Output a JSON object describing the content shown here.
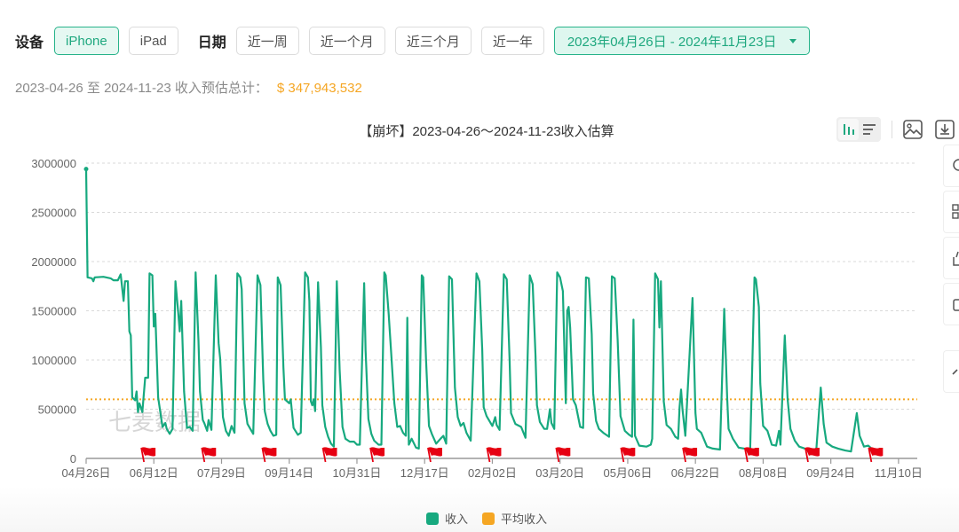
{
  "filters": {
    "device_label": "设备",
    "devices": [
      {
        "label": "iPhone",
        "active": true
      },
      {
        "label": "iPad",
        "active": false
      }
    ],
    "date_label": "日期",
    "date_presets": [
      {
        "label": "近一周"
      },
      {
        "label": "近一个月"
      },
      {
        "label": "近三个月"
      },
      {
        "label": "近一年"
      }
    ],
    "date_range": "2023年04月26日 - 2024年11月23日"
  },
  "summary": {
    "text": "2023-04-26 至 2024-11-23 收入预估总计：",
    "amount": "$ 347,943,532"
  },
  "toolbar": {
    "icons": [
      "bar-view-icon",
      "list-view-icon",
      "image-export-icon",
      "download-icon"
    ]
  },
  "side_tabs": [
    "lightbulb-icon",
    "qr-code-icon",
    "thumbs-up-icon",
    "robot-icon",
    "collapse-icon"
  ],
  "watermark": "七麦数据",
  "colors": {
    "accent": "#1fa87f",
    "revenue_line": "#17a97f",
    "average_line": "#f5a623",
    "flag": "#e60012"
  },
  "chart_data": {
    "type": "line",
    "title": "【崩坏】2023-04-26～2024-11-23收入估算",
    "xlabel": "",
    "ylabel": "",
    "x_start": "2023-04-26",
    "x_end": "2024-11-23",
    "x_tick_labels": [
      "04月26日",
      "06月12日",
      "07月29日",
      "09月14日",
      "10月31日",
      "12月17日",
      "02月02日",
      "03月20日",
      "05月06日",
      "06月22日",
      "08月08日",
      "09月24日",
      "11月10日"
    ],
    "x_tick_day_offsets": [
      0,
      47,
      94,
      141,
      188,
      235,
      282,
      329,
      376,
      423,
      470,
      517,
      564
    ],
    "y_ticks": [
      0,
      500000,
      1000000,
      1500000,
      2000000,
      2500000,
      3000000
    ],
    "ylim": [
      0,
      3000000
    ],
    "grid": true,
    "legend_position": "bottom-center",
    "legend": [
      "收入",
      "平均收入"
    ],
    "average_value": 600000,
    "version_flag_day_offsets": [
      42,
      84,
      126,
      168,
      201,
      241,
      282,
      330,
      375,
      418,
      461,
      503,
      547
    ],
    "series": [
      {
        "name": "收入",
        "points_day_value": [
          [
            0,
            2940000
          ],
          [
            1,
            1840000
          ],
          [
            4,
            1830000
          ],
          [
            5,
            1800000
          ],
          [
            6,
            1840000
          ],
          [
            12,
            1845000
          ],
          [
            17,
            1830000
          ],
          [
            19,
            1810000
          ],
          [
            22,
            1810000
          ],
          [
            24,
            1870000
          ],
          [
            26,
            1600000
          ],
          [
            27,
            1800000
          ],
          [
            29,
            1800000
          ],
          [
            30,
            1290000
          ],
          [
            31,
            1250000
          ],
          [
            32,
            620000
          ],
          [
            34,
            590000
          ],
          [
            35,
            680000
          ],
          [
            36,
            470000
          ],
          [
            37,
            560000
          ],
          [
            38,
            520000
          ],
          [
            39,
            470000
          ],
          [
            41,
            820000
          ],
          [
            43,
            820000
          ],
          [
            44,
            1880000
          ],
          [
            46,
            1860000
          ],
          [
            47,
            1340000
          ],
          [
            48,
            1470000
          ],
          [
            50,
            620000
          ],
          [
            53,
            320000
          ],
          [
            55,
            360000
          ],
          [
            56,
            300000
          ],
          [
            58,
            250000
          ],
          [
            60,
            300000
          ],
          [
            62,
            1800000
          ],
          [
            64,
            1470000
          ],
          [
            65,
            1290000
          ],
          [
            66,
            1600000
          ],
          [
            68,
            680000
          ],
          [
            70,
            310000
          ],
          [
            72,
            320000
          ],
          [
            74,
            280000
          ],
          [
            76,
            1890000
          ],
          [
            78,
            1200000
          ],
          [
            79,
            680000
          ],
          [
            81,
            390000
          ],
          [
            82,
            360000
          ],
          [
            84,
            280000
          ],
          [
            85,
            390000
          ],
          [
            87,
            290000
          ],
          [
            90,
            1860000
          ],
          [
            92,
            1170000
          ],
          [
            93,
            1020000
          ],
          [
            95,
            420000
          ],
          [
            97,
            280000
          ],
          [
            99,
            230000
          ],
          [
            101,
            330000
          ],
          [
            103,
            260000
          ],
          [
            105,
            1880000
          ],
          [
            107,
            1840000
          ],
          [
            108,
            1720000
          ],
          [
            110,
            560000
          ],
          [
            112,
            350000
          ],
          [
            114,
            300000
          ],
          [
            116,
            250000
          ],
          [
            119,
            1860000
          ],
          [
            121,
            1760000
          ],
          [
            123,
            800000
          ],
          [
            124,
            480000
          ],
          [
            126,
            350000
          ],
          [
            128,
            280000
          ],
          [
            130,
            230000
          ],
          [
            132,
            240000
          ],
          [
            133,
            1840000
          ],
          [
            135,
            1760000
          ],
          [
            137,
            920000
          ],
          [
            138,
            600000
          ],
          [
            141,
            560000
          ],
          [
            142,
            600000
          ],
          [
            144,
            310000
          ],
          [
            147,
            240000
          ],
          [
            149,
            260000
          ],
          [
            152,
            1890000
          ],
          [
            154,
            1840000
          ],
          [
            155,
            1600000
          ],
          [
            156,
            580000
          ],
          [
            157,
            540000
          ],
          [
            158,
            600000
          ],
          [
            159,
            480000
          ],
          [
            161,
            1790000
          ],
          [
            163,
            1130000
          ],
          [
            164,
            540000
          ],
          [
            166,
            320000
          ],
          [
            168,
            220000
          ],
          [
            170,
            150000
          ],
          [
            172,
            120000
          ],
          [
            174,
            1800000
          ],
          [
            176,
            900000
          ],
          [
            178,
            320000
          ],
          [
            180,
            200000
          ],
          [
            183,
            170000
          ],
          [
            186,
            170000
          ],
          [
            188,
            140000
          ],
          [
            190,
            140000
          ],
          [
            193,
            1780000
          ],
          [
            194,
            1100000
          ],
          [
            196,
            400000
          ],
          [
            198,
            250000
          ],
          [
            200,
            180000
          ],
          [
            203,
            140000
          ],
          [
            205,
            140000
          ],
          [
            207,
            1890000
          ],
          [
            208,
            1860000
          ],
          [
            210,
            1470000
          ],
          [
            212,
            1020000
          ],
          [
            214,
            560000
          ],
          [
            216,
            320000
          ],
          [
            218,
            330000
          ],
          [
            220,
            260000
          ],
          [
            222,
            230000
          ],
          [
            223,
            1430000
          ],
          [
            224,
            140000
          ],
          [
            226,
            200000
          ],
          [
            229,
            110000
          ],
          [
            231,
            100000
          ],
          [
            233,
            1860000
          ],
          [
            234,
            1840000
          ],
          [
            236,
            1000000
          ],
          [
            238,
            330000
          ],
          [
            240,
            250000
          ],
          [
            243,
            150000
          ],
          [
            246,
            200000
          ],
          [
            248,
            230000
          ],
          [
            250,
            150000
          ],
          [
            252,
            1850000
          ],
          [
            254,
            1820000
          ],
          [
            256,
            720000
          ],
          [
            258,
            420000
          ],
          [
            260,
            330000
          ],
          [
            262,
            360000
          ],
          [
            264,
            260000
          ],
          [
            267,
            180000
          ],
          [
            271,
            1880000
          ],
          [
            273,
            1800000
          ],
          [
            275,
            1100000
          ],
          [
            276,
            520000
          ],
          [
            278,
            430000
          ],
          [
            280,
            380000
          ],
          [
            282,
            330000
          ],
          [
            284,
            420000
          ],
          [
            285,
            340000
          ],
          [
            287,
            290000
          ],
          [
            290,
            1870000
          ],
          [
            292,
            1820000
          ],
          [
            294,
            1000000
          ],
          [
            295,
            460000
          ],
          [
            298,
            350000
          ],
          [
            302,
            320000
          ],
          [
            305,
            210000
          ],
          [
            308,
            1860000
          ],
          [
            310,
            1770000
          ],
          [
            312,
            1040000
          ],
          [
            313,
            540000
          ],
          [
            315,
            370000
          ],
          [
            318,
            300000
          ],
          [
            320,
            300000
          ],
          [
            322,
            500000
          ],
          [
            323,
            360000
          ],
          [
            325,
            300000
          ],
          [
            327,
            1890000
          ],
          [
            329,
            1840000
          ],
          [
            331,
            1700000
          ],
          [
            333,
            560000
          ],
          [
            334,
            1500000
          ],
          [
            335,
            1540000
          ],
          [
            336,
            1330000
          ],
          [
            338,
            600000
          ],
          [
            340,
            540000
          ],
          [
            343,
            320000
          ],
          [
            345,
            310000
          ],
          [
            347,
            1840000
          ],
          [
            349,
            1830000
          ],
          [
            351,
            1260000
          ],
          [
            352,
            660000
          ],
          [
            354,
            380000
          ],
          [
            356,
            300000
          ],
          [
            359,
            260000
          ],
          [
            363,
            220000
          ],
          [
            365,
            1850000
          ],
          [
            367,
            1830000
          ],
          [
            369,
            1200000
          ],
          [
            371,
            430000
          ],
          [
            374,
            280000
          ],
          [
            377,
            240000
          ],
          [
            379,
            220000
          ],
          [
            380,
            1410000
          ],
          [
            381,
            230000
          ],
          [
            384,
            130000
          ],
          [
            389,
            120000
          ],
          [
            392,
            140000
          ],
          [
            393,
            200000
          ],
          [
            395,
            1880000
          ],
          [
            397,
            1820000
          ],
          [
            398,
            1330000
          ],
          [
            399,
            1800000
          ],
          [
            401,
            580000
          ],
          [
            403,
            340000
          ],
          [
            406,
            300000
          ],
          [
            409,
            220000
          ],
          [
            411,
            200000
          ],
          [
            412,
            520000
          ],
          [
            413,
            700000
          ],
          [
            414,
            500000
          ],
          [
            416,
            230000
          ],
          [
            421,
            1630000
          ],
          [
            423,
            460000
          ],
          [
            424,
            300000
          ],
          [
            427,
            260000
          ],
          [
            431,
            120000
          ],
          [
            435,
            100000
          ],
          [
            440,
            90000
          ],
          [
            443,
            1520000
          ],
          [
            445,
            620000
          ],
          [
            446,
            300000
          ],
          [
            449,
            200000
          ],
          [
            453,
            110000
          ],
          [
            457,
            100000
          ],
          [
            461,
            90000
          ],
          [
            464,
            1840000
          ],
          [
            465,
            1820000
          ],
          [
            467,
            1540000
          ],
          [
            468,
            760000
          ],
          [
            470,
            330000
          ],
          [
            473,
            280000
          ],
          [
            476,
            140000
          ],
          [
            479,
            130000
          ],
          [
            481,
            280000
          ],
          [
            482,
            140000
          ],
          [
            485,
            1250000
          ],
          [
            487,
            600000
          ],
          [
            489,
            300000
          ],
          [
            492,
            180000
          ],
          [
            495,
            120000
          ],
          [
            499,
            100000
          ],
          [
            503,
            90000
          ],
          [
            507,
            100000
          ],
          [
            510,
            720000
          ],
          [
            512,
            350000
          ],
          [
            514,
            160000
          ],
          [
            518,
            120000
          ],
          [
            522,
            100000
          ],
          [
            527,
            80000
          ],
          [
            531,
            70000
          ],
          [
            535,
            460000
          ],
          [
            537,
            230000
          ],
          [
            540,
            120000
          ],
          [
            543,
            130000
          ],
          [
            546,
            90000
          ],
          [
            549,
            70000
          ]
        ]
      },
      {
        "name": "平均收入",
        "constant": 600000
      }
    ]
  }
}
